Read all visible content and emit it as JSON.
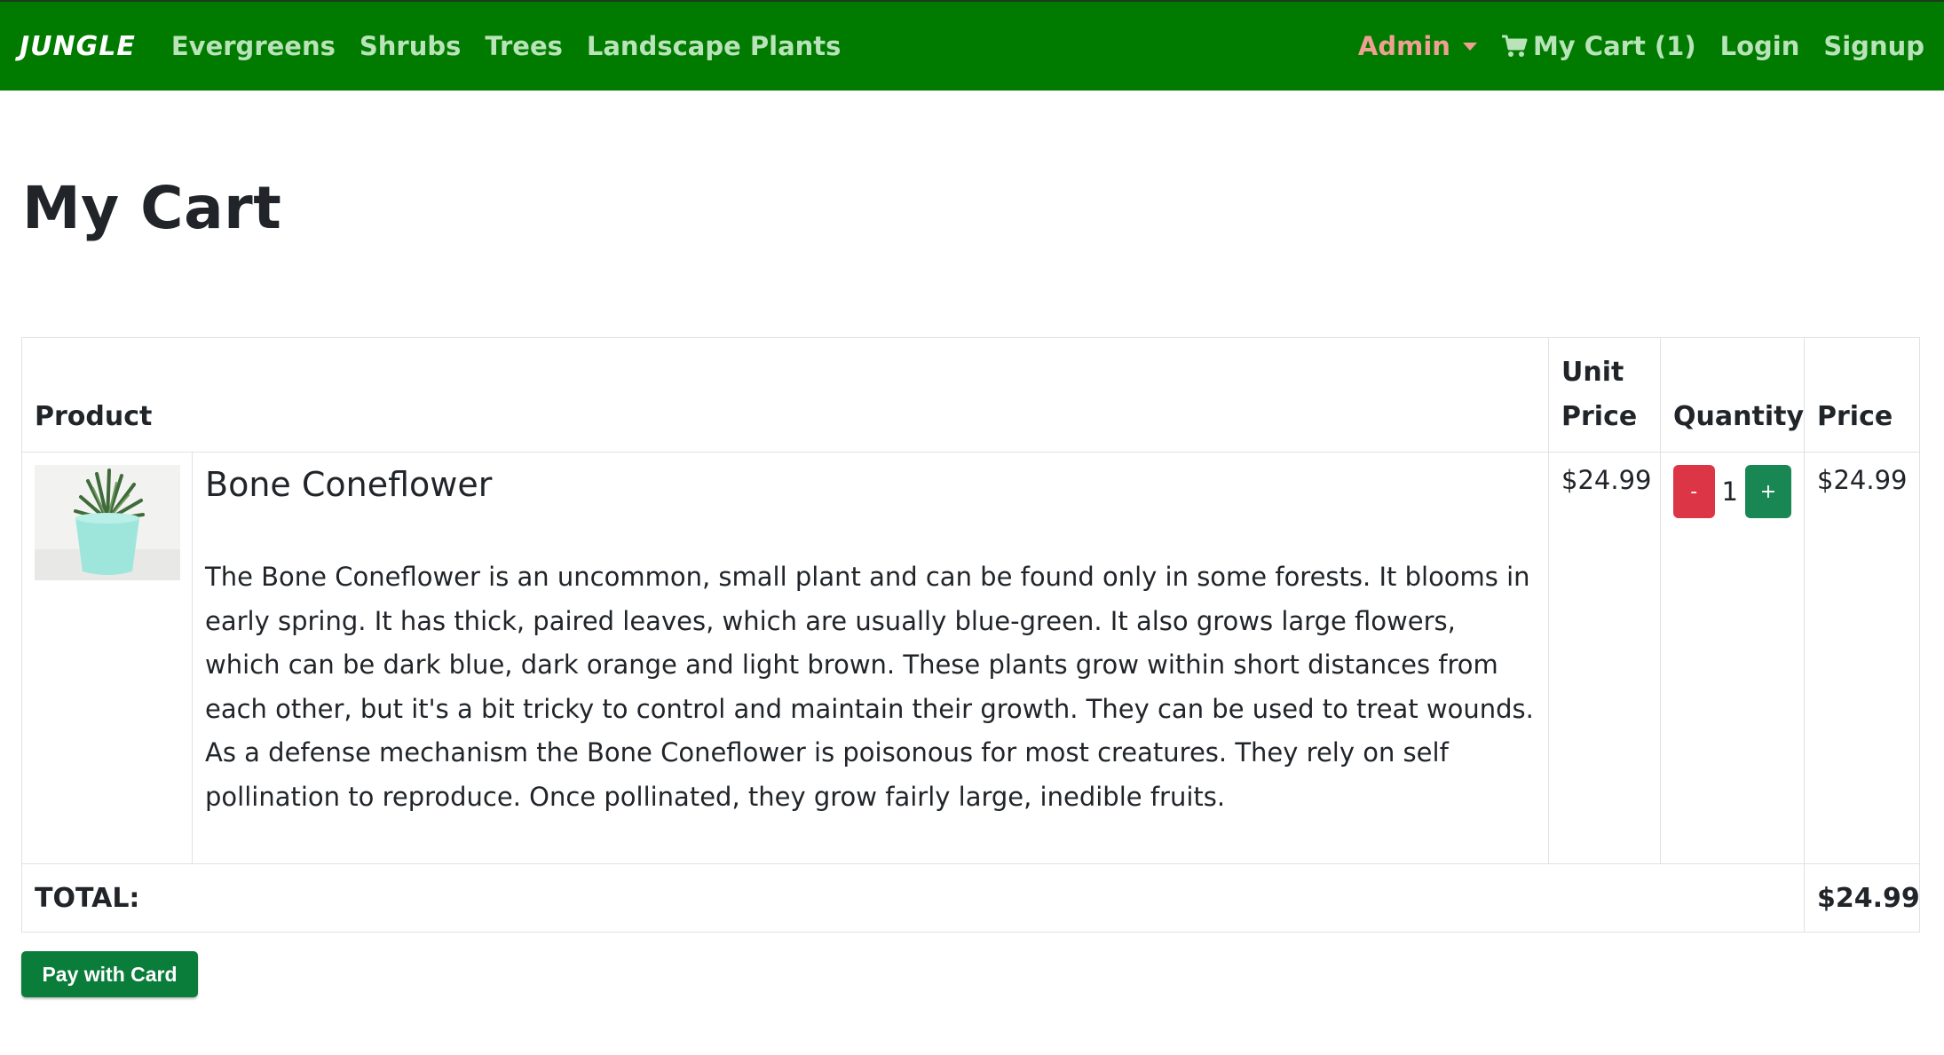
{
  "navbar": {
    "brand": "JUNGLE",
    "links": [
      {
        "label": "Evergreens"
      },
      {
        "label": "Shrubs"
      },
      {
        "label": "Trees"
      },
      {
        "label": "Landscape Plants"
      }
    ],
    "admin_label": "Admin",
    "cart_label": "My Cart (1)",
    "login_label": "Login",
    "signup_label": "Signup"
  },
  "page": {
    "title": "My Cart"
  },
  "table": {
    "headers": {
      "product": "Product",
      "unit_price_line1": "Unit",
      "unit_price_line2": "Price",
      "quantity": "Quantity",
      "price": "Price"
    },
    "items": [
      {
        "name": "Bone Coneflower",
        "description": "The Bone Coneflower is an uncommon, small plant and can be found only in some forests. It blooms in early spring. It has thick, paired leaves, which are usually blue-green. It also grows large flowers, which can be dark blue, dark orange and light brown. These plants grow within short distances from each other, but it's a bit tricky to control and maintain their growth. They can be used to treat wounds. As a defense mechanism the Bone Coneflower is poisonous for most creatures. They rely on self pollination to reproduce. Once pollinated, they grow fairly large, inedible fruits.",
        "unit_price": "$24.99",
        "quantity": "1",
        "minus_label": "-",
        "plus_label": "+",
        "price": "$24.99"
      }
    ],
    "total_label": "TOTAL:",
    "total_value": "$24.99"
  },
  "checkout": {
    "pay_label": "Pay with Card"
  },
  "colors": {
    "navbar_bg": "#007b00",
    "nav_link": "#b9e3b9",
    "admin_link": "#f0a090",
    "danger": "#dc3545",
    "success": "#198754",
    "pay_button": "#0a7d3b"
  }
}
